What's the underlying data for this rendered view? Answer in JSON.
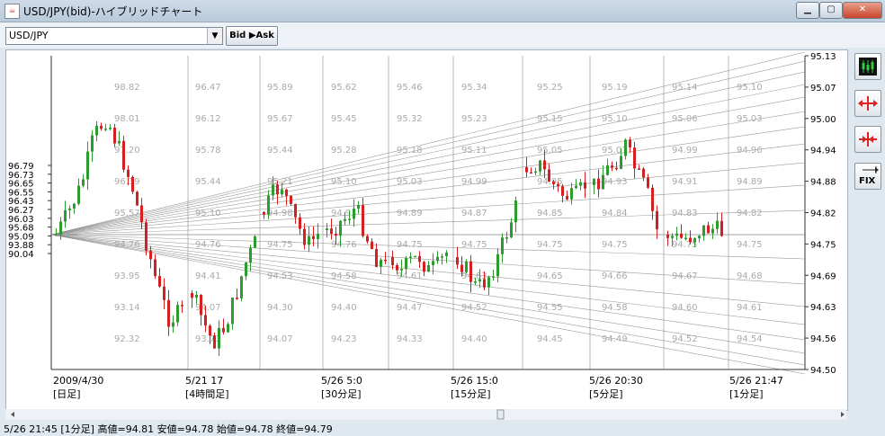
{
  "window": {
    "title": "USD/JPY(bid)-ハイブリッドチャート",
    "controls": [
      "minimize-icon",
      "maximize-icon",
      "close-icon"
    ]
  },
  "toolbar": {
    "symbol_select": "USD/JPY",
    "bid_ask_button": "Bid ▶Ask"
  },
  "colors": {
    "up": "#2e9b2e",
    "down": "#d42020",
    "grid": "#b8b8b8",
    "fan": "#8a8a8a",
    "label": "#aaaaaa"
  },
  "y_axis": {
    "ticks": [
      "95.13",
      "95.07",
      "95.00",
      "94.94",
      "94.88",
      "94.82",
      "94.75",
      "94.69",
      "94.63",
      "94.56",
      "94.50"
    ]
  },
  "left_axis": {
    "ticks": [
      "96.79",
      "96.73",
      "96.65",
      "96.55",
      "96.43",
      "96.27",
      "96.03",
      "95.68",
      "95.09",
      "93.88",
      "90.04"
    ]
  },
  "x_axis": [
    {
      "date": "2009/4/30",
      "period": "[日足]"
    },
    {
      "date": "5/21 17",
      "period": "[4時間足]"
    },
    {
      "date": "5/26 5:0",
      "period": "[30分足]"
    },
    {
      "date": "5/26 15:0",
      "period": "[15分足]"
    },
    {
      "date": "5/26 20:30",
      "period": "[5分足]"
    },
    {
      "date": "5/26 21:47",
      "period": "[1分足]"
    }
  ],
  "section_labels": [
    [
      "98.82",
      "98.01",
      "97.20",
      "96.39",
      "95.57",
      "94.76",
      "93.95",
      "93.14",
      "92.32"
    ],
    [
      "96.47",
      "96.12",
      "95.78",
      "95.44",
      "95.10",
      "94.76",
      "94.41",
      "94.07",
      "93.73"
    ],
    [
      "95.89",
      "95.67",
      "95.44",
      "95.21",
      "94.98",
      "94.75",
      "94.53",
      "94.30",
      "94.07"
    ],
    [
      "95.62",
      "95.45",
      "95.28",
      "95.10",
      "94.93",
      "94.76",
      "94.58",
      "94.40",
      "94.23"
    ],
    [
      "95.46",
      "95.32",
      "95.18",
      "95.03",
      "94.89",
      "94.75",
      "94.61",
      "94.47",
      "94.33"
    ],
    [
      "95.34",
      "95.23",
      "95.11",
      "94.99",
      "94.87",
      "94.75",
      "94.63",
      "94.52",
      "94.40"
    ],
    [
      "95.25",
      "95.15",
      "95.05",
      "94.95",
      "94.85",
      "94.75",
      "94.65",
      "94.55",
      "94.45"
    ],
    [
      "95.19",
      "95.10",
      "95.01",
      "94.93",
      "94.84",
      "94.75",
      "94.66",
      "94.58",
      "94.49"
    ],
    [
      "95.14",
      "95.06",
      "94.99",
      "94.91",
      "94.83",
      "94.75",
      "94.67",
      "94.60",
      "94.52"
    ],
    [
      "95.10",
      "95.03",
      "94.96",
      "94.89",
      "94.82",
      "94.75",
      "94.68",
      "94.61",
      "94.54"
    ]
  ],
  "sidebar": {
    "buttons": [
      "candlestick-icon",
      "expand-horizontal-icon",
      "compress-horizontal-icon",
      "fix-icon"
    ],
    "fix_label": "FIX"
  },
  "status_bar": "5/26 21:45 [1分足] 高値=94.81 安値=94.78 始値=94.78 終値=94.79"
}
